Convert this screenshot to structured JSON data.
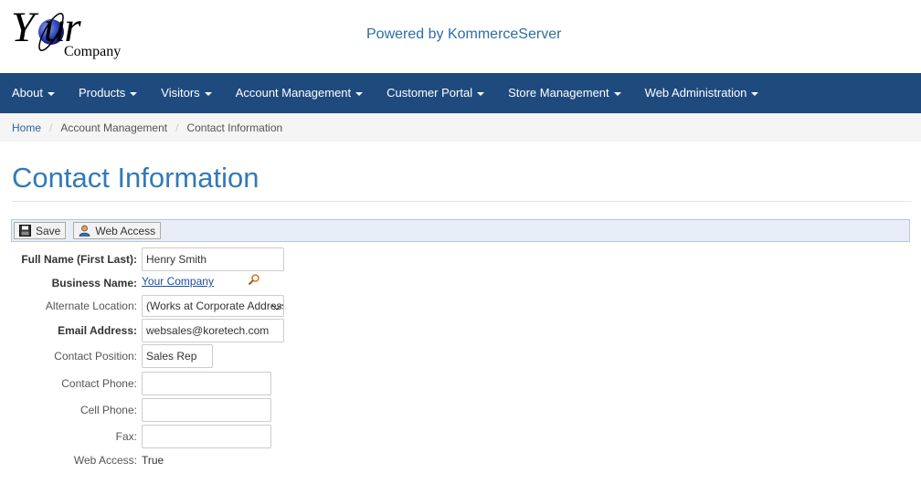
{
  "header": {
    "logo_your": "Y  ur",
    "logo_company": "Company",
    "powered_by": "Powered by KommerceServer"
  },
  "nav": {
    "items": [
      {
        "label": "About"
      },
      {
        "label": "Products"
      },
      {
        "label": "Visitors"
      },
      {
        "label": "Account Management"
      },
      {
        "label": "Customer Portal"
      },
      {
        "label": "Store Management"
      },
      {
        "label": "Web Administration"
      }
    ]
  },
  "breadcrumb": {
    "home": "Home",
    "sep": "/",
    "level1": "Account Management",
    "current": "Contact Information"
  },
  "page_title": "Contact Information",
  "toolbar": {
    "save_label": "Save",
    "web_access_label": "Web Access"
  },
  "form": {
    "full_name_label": "Full Name (First Last):",
    "full_name_value": "Henry Smith",
    "business_name_label": "Business Name:",
    "business_name_value": "Your Company",
    "alt_location_label": "Alternate Location:",
    "alt_location_value": "(Works at Corporate Address)",
    "email_label": "Email Address:",
    "email_value": "websales@koretech.com",
    "position_label": "Contact Position:",
    "position_value": "Sales Rep",
    "contact_phone_label": "Contact Phone:",
    "contact_phone_value": "",
    "cell_phone_label": "Cell Phone:",
    "cell_phone_value": "",
    "fax_label": "Fax:",
    "fax_value": "",
    "web_access_label": "Web Access:",
    "web_access_value": "True"
  },
  "colors": {
    "nav_bg": "#1e4a7e",
    "title": "#337ab7",
    "link": "#1a4f9c"
  },
  "icons": [
    "globe-logo-icon",
    "save-icon",
    "user-icon",
    "search-icon"
  ]
}
